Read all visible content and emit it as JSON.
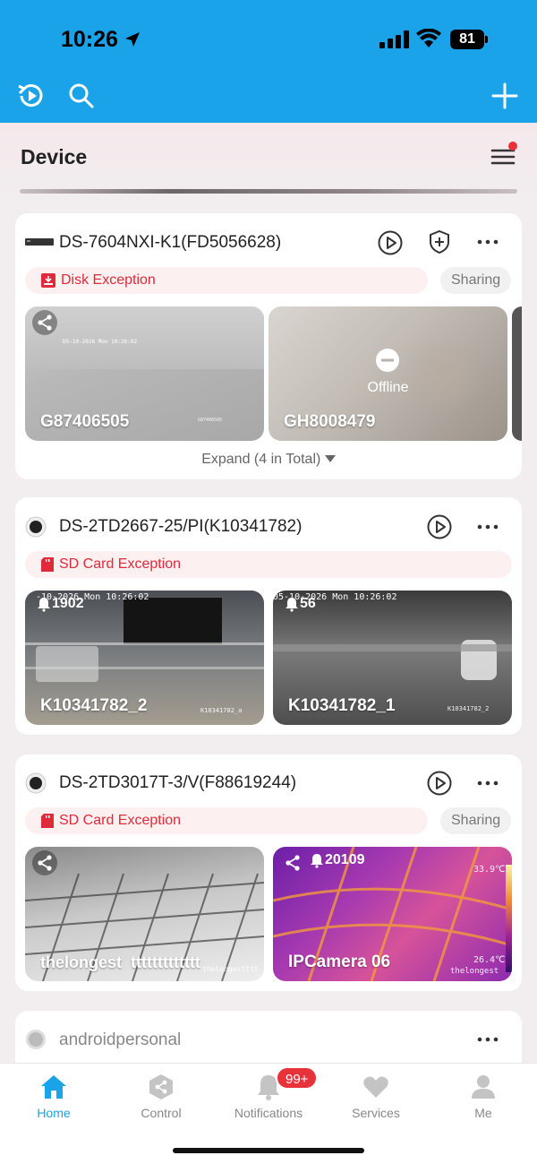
{
  "status_bar": {
    "time": "10:26",
    "battery": "81"
  },
  "header": {
    "title": "Device"
  },
  "devices": [
    {
      "name": "DS-7604NXI-K1(FD5056628)",
      "exception": "Disk Exception",
      "sharing": "Sharing",
      "channels": [
        {
          "name": "G87406505",
          "osd": "DS-10-2026 Mon 10:26:02",
          "stamp": "G87406505"
        },
        {
          "name": "GH8008479",
          "status": "Offline"
        }
      ],
      "expand": "Expand (4 in Total)"
    },
    {
      "name": "DS-2TD2667-25/PI(K10341782)",
      "exception": "SD Card Exception",
      "channels": [
        {
          "name": "K10341782_2",
          "alarm_count": "1902",
          "osd": "-10-2026 Mon 10:26:02",
          "stamp": "K10341782_a"
        },
        {
          "name": "K10341782_1",
          "alarm_count": "56",
          "osd": "05-10-2026 Mon 10:26:02",
          "stamp": "K10341782_2"
        }
      ]
    },
    {
      "name": "DS-2TD3017T-3/V(F88619244)",
      "exception": "SD Card Exception",
      "sharing": "Sharing",
      "channels": [
        {
          "name": "thelongest  ttttttttttttt",
          "stamp": "thelongestttt"
        },
        {
          "name": "IPCamera 06",
          "alarm_count": "20109",
          "temp_max": "33.9℃",
          "temp_min": "26.4℃",
          "stamp": "thelongest"
        }
      ]
    },
    {
      "name": "androidpersonal"
    }
  ],
  "tabs": [
    {
      "label": "Home",
      "icon": "home-icon",
      "active": true
    },
    {
      "label": "Control",
      "icon": "control-icon"
    },
    {
      "label": "Notifications",
      "icon": "bell-icon",
      "badge": "99+"
    },
    {
      "label": "Services",
      "icon": "heart-icon"
    },
    {
      "label": "Me",
      "icon": "person-icon"
    }
  ],
  "colors": {
    "accent": "#1aa3e8",
    "alert": "#e0293a",
    "badge": "#e8323a"
  }
}
